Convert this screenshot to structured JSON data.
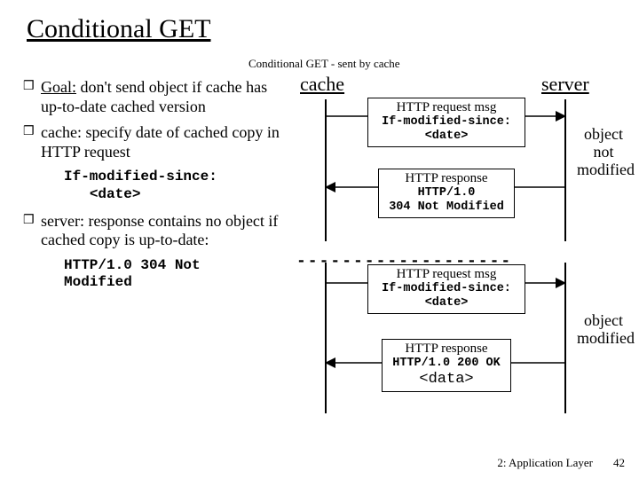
{
  "title": "Conditional GET",
  "subtitle": "Conditional GET - sent by cache",
  "bullets": {
    "goal_label": "Goal:",
    "goal_rest": " don't send object if cache has up-to-date cached version",
    "cache": "cache: specify date of cached copy in HTTP request",
    "cache_code1": "If-modified-since:",
    "cache_code2": "<date>",
    "server": "server: response contains no object if cached copy is up-to-date:",
    "server_code1": "HTTP/1.0 304 Not",
    "server_code2": "Modified"
  },
  "diagram": {
    "hdr_cache": "cache",
    "hdr_server": "server",
    "req1_title": "HTTP request msg",
    "req1_l1": "If-modified-since:",
    "req1_l2": "<date>",
    "resp1_title": "HTTP response",
    "resp1_l1": "HTTP/1.0",
    "resp1_l2": "304 Not Modified",
    "note1_l1": "object",
    "note1_l2": "not",
    "note1_l3": "modified",
    "divider": "-------------------",
    "req2_title": "HTTP request msg",
    "req2_l1": "If-modified-since:",
    "req2_l2": "<date>",
    "resp2_title": "HTTP response",
    "resp2_l1": "HTTP/1.0 200 OK",
    "resp2_l2": "<data>",
    "note2_l1": "object",
    "note2_l2": "modified"
  },
  "footer": {
    "chapter": "2: Application Layer",
    "page": "42"
  }
}
